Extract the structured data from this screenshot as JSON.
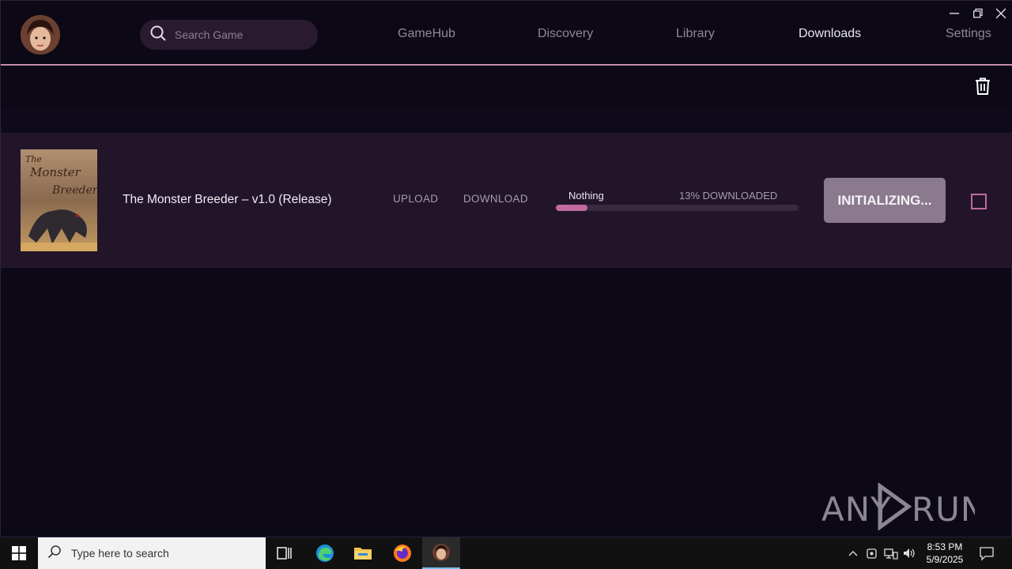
{
  "header": {
    "search_placeholder": "Search Game",
    "nav": [
      {
        "label": "GameHub",
        "active": false
      },
      {
        "label": "Discovery",
        "active": false
      },
      {
        "label": "Library",
        "active": false
      },
      {
        "label": "Downloads",
        "active": true
      },
      {
        "label": "Settings",
        "active": false
      }
    ],
    "window_controls": [
      "minimize-icon",
      "restore-icon",
      "close-icon"
    ]
  },
  "toolbar": {
    "icon": "trash-icon"
  },
  "downloads": [
    {
      "title": "The Monster Breeder – v1.0 (Release)",
      "cover_text": "The Monster Breeder",
      "upload_label": "UPLOAD",
      "download_label": "DOWNLOAD",
      "status_label": "Nothing",
      "progress_text": "13% DOWNLOADED",
      "progress_fraction": 0.13,
      "action_label": "INITIALIZING...",
      "selected": false
    }
  ],
  "watermark": "ANY RUN",
  "taskbar": {
    "search_placeholder": "Type here to search",
    "time": "8:53 PM",
    "date": "5/9/2025",
    "icons": [
      "windows-start-icon",
      "task-view-icon",
      "edge-icon",
      "file-explorer-icon",
      "firefox-icon",
      "app-icon"
    ]
  },
  "colors": {
    "accent": "#c16a9e",
    "background": "#0c0816",
    "row_background": "#22152a",
    "button": "#8b7a8e"
  }
}
